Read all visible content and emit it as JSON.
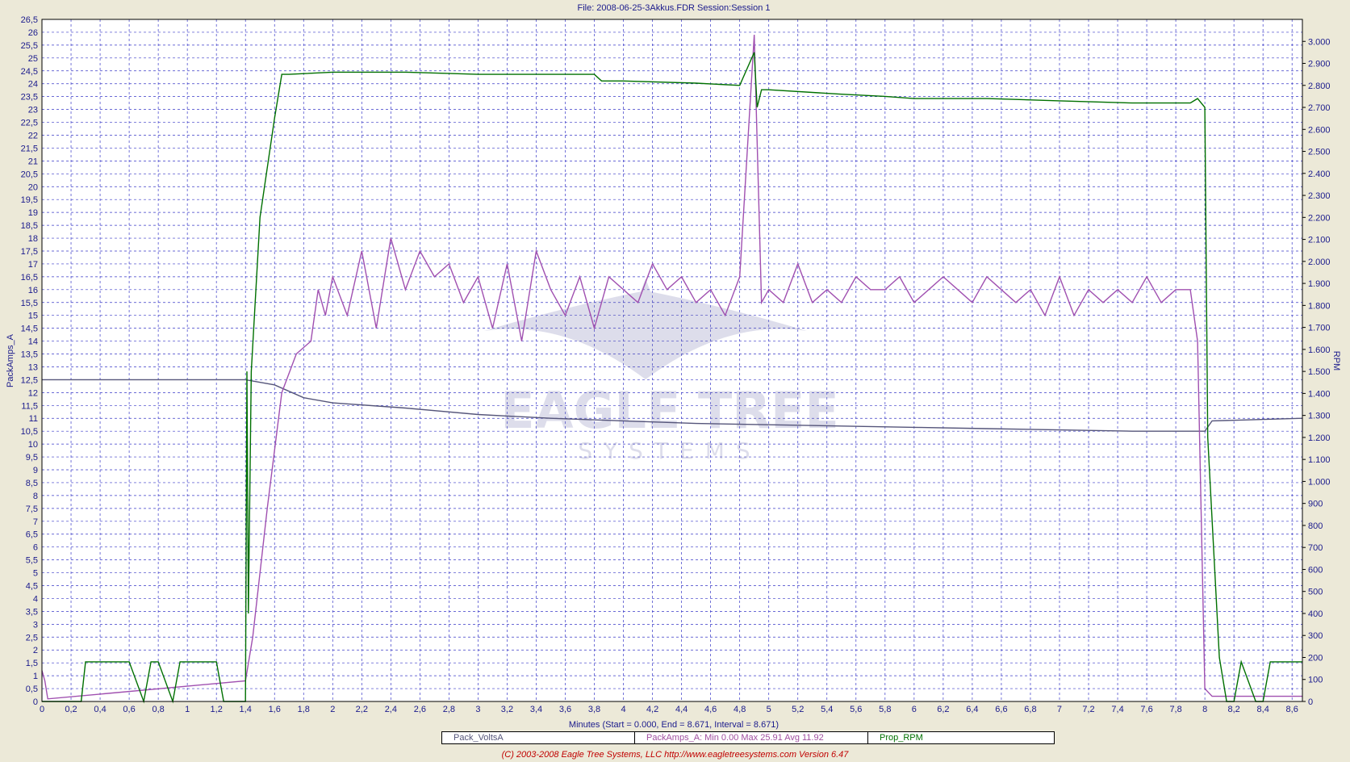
{
  "chart_data": {
    "type": "line",
    "title": "File: 2008-06-25-3Akkus.FDR   Session:Session 1",
    "xlabel": "Minutes (Start = 0.000,  End = 8.671,  Interval =  8.671)",
    "ylabel_left": "PackAmps_A",
    "ylabel_right": "RPM",
    "xlim": [
      0,
      8.671
    ],
    "ylim_left": [
      0,
      26.5
    ],
    "ylim_right": [
      0,
      3100
    ],
    "x_ticks": [
      "0",
      "0,2",
      "0,4",
      "0,6",
      "0,8",
      "1",
      "1,2",
      "1,4",
      "1,6",
      "1,8",
      "2",
      "2,2",
      "2,4",
      "2,6",
      "2,8",
      "3",
      "3,2",
      "3,4",
      "3,6",
      "3,8",
      "4",
      "4,2",
      "4,4",
      "4,6",
      "4,8",
      "5",
      "5,2",
      "5,4",
      "5,6",
      "5,8",
      "6",
      "6,2",
      "6,4",
      "6,6",
      "6,8",
      "7",
      "7,2",
      "7,4",
      "7,6",
      "7,8",
      "8",
      "8,2",
      "8,4",
      "8,6"
    ],
    "y_left_ticks": [
      "0",
      "0,5",
      "1",
      "1,5",
      "2",
      "2,5",
      "3",
      "3,5",
      "4",
      "4,5",
      "5",
      "5,5",
      "6",
      "6,5",
      "7",
      "7,5",
      "8",
      "8,5",
      "9",
      "9,5",
      "10",
      "10,5",
      "11",
      "11,5",
      "12",
      "12,5",
      "13",
      "13,5",
      "14",
      "14,5",
      "15",
      "15,5",
      "16",
      "16,5",
      "17",
      "17,5",
      "18",
      "18,5",
      "19",
      "19,5",
      "20",
      "20,5",
      "21",
      "21,5",
      "22",
      "22,5",
      "23",
      "23,5",
      "24",
      "24,5",
      "25",
      "25,5",
      "26",
      "26,5"
    ],
    "y_right_ticks": [
      "0",
      "100",
      "200",
      "300",
      "400",
      "500",
      "600",
      "700",
      "800",
      "900",
      "1.000",
      "1.100",
      "1.200",
      "1.300",
      "1.400",
      "1.500",
      "1.600",
      "1.700",
      "1.800",
      "1.900",
      "2.000",
      "2.100",
      "2.200",
      "2.300",
      "2.400",
      "2.500",
      "2.600",
      "2.700",
      "2.800",
      "2.900",
      "3.000"
    ],
    "grid": true,
    "series": [
      {
        "name": "Pack_VoltsA",
        "color": "#55557a",
        "axis": "left",
        "x": [
          0,
          0.5,
          1.0,
          1.4,
          1.6,
          1.8,
          2.0,
          2.5,
          3.0,
          3.5,
          4.0,
          4.5,
          5.0,
          5.5,
          6.0,
          6.5,
          7.0,
          7.5,
          8.0,
          8.05,
          8.671
        ],
        "y": [
          12.5,
          12.5,
          12.5,
          12.5,
          12.3,
          11.8,
          11.6,
          11.4,
          11.15,
          11.0,
          10.9,
          10.8,
          10.75,
          10.7,
          10.65,
          10.6,
          10.55,
          10.5,
          10.5,
          10.9,
          11.0
        ]
      },
      {
        "name": "PackAmps_A",
        "color": "#a050b0",
        "axis": "left",
        "x": [
          0,
          0.02,
          0.04,
          1.4,
          1.45,
          1.55,
          1.65,
          1.75,
          1.85,
          1.9,
          1.95,
          2.0,
          2.1,
          2.2,
          2.3,
          2.4,
          2.5,
          2.6,
          2.7,
          2.8,
          2.9,
          3.0,
          3.1,
          3.2,
          3.3,
          3.4,
          3.5,
          3.6,
          3.7,
          3.8,
          3.9,
          4.0,
          4.1,
          4.2,
          4.3,
          4.4,
          4.5,
          4.6,
          4.7,
          4.8,
          4.9,
          4.95,
          5.0,
          5.1,
          5.2,
          5.3,
          5.4,
          5.5,
          5.6,
          5.7,
          5.8,
          5.9,
          6.0,
          6.1,
          6.2,
          6.3,
          6.4,
          6.5,
          6.6,
          6.7,
          6.8,
          6.9,
          7.0,
          7.1,
          7.2,
          7.3,
          7.4,
          7.5,
          7.6,
          7.7,
          7.8,
          7.9,
          7.95,
          8.0,
          8.05,
          8.671
        ],
        "y": [
          1.2,
          0.8,
          0.1,
          0.8,
          2.5,
          7.5,
          12.0,
          13.5,
          14.0,
          16.0,
          15.0,
          16.5,
          15.0,
          17.5,
          14.5,
          18.0,
          16.0,
          17.5,
          16.5,
          17.0,
          15.5,
          16.5,
          14.5,
          17.0,
          14.0,
          17.5,
          16.0,
          15.0,
          16.5,
          14.5,
          16.5,
          16.0,
          15.5,
          17.0,
          16.0,
          16.5,
          15.5,
          16.0,
          15.0,
          16.5,
          25.9,
          15.5,
          16.0,
          15.5,
          17.0,
          15.5,
          16.0,
          15.5,
          16.5,
          16.0,
          16.0,
          16.5,
          15.5,
          16.0,
          16.5,
          16.0,
          15.5,
          16.5,
          16.0,
          15.5,
          16.0,
          15.0,
          16.5,
          15.0,
          16.0,
          15.5,
          16.0,
          15.5,
          16.5,
          15.5,
          16.0,
          16.0,
          14.0,
          0.5,
          0.2,
          0.2
        ]
      },
      {
        "name": "Prop_RPM",
        "color": "#007000",
        "axis": "right",
        "x": [
          0,
          0.27,
          0.3,
          0.35,
          0.6,
          0.7,
          0.75,
          0.8,
          0.9,
          0.95,
          1.0,
          1.1,
          1.2,
          1.25,
          1.4,
          1.41,
          1.42,
          1.44,
          1.5,
          1.6,
          1.65,
          1.7,
          2.0,
          2.5,
          3.0,
          3.5,
          3.8,
          3.85,
          4.0,
          4.5,
          4.8,
          4.9,
          4.92,
          4.95,
          5.0,
          5.5,
          5.8,
          6.0,
          6.5,
          7.0,
          7.5,
          7.9,
          7.95,
          8.0,
          8.02,
          8.1,
          8.15,
          8.2,
          8.25,
          8.35,
          8.4,
          8.45,
          8.671
        ],
        "y": [
          0,
          0,
          180,
          180,
          180,
          0,
          180,
          180,
          0,
          180,
          180,
          180,
          180,
          0,
          0,
          1500,
          400,
          1500,
          2200,
          2650,
          2850,
          2850,
          2860,
          2860,
          2850,
          2850,
          2850,
          2820,
          2820,
          2810,
          2800,
          2950,
          2700,
          2780,
          2780,
          2760,
          2750,
          2740,
          2740,
          2730,
          2720,
          2720,
          2740,
          2700,
          1200,
          200,
          0,
          0,
          180,
          0,
          0,
          180,
          180
        ]
      }
    ]
  },
  "legend": {
    "volts": "Pack_VoltsA",
    "amps": "PackAmps_A:  Min 0.00   Max 25.91   Avg 11.92",
    "rpm": "Prop_RPM"
  },
  "footer": "(C) 2003-2008 Eagle Tree Systems, LLC      http://www.eagletreesystems.com     Version 6.47"
}
